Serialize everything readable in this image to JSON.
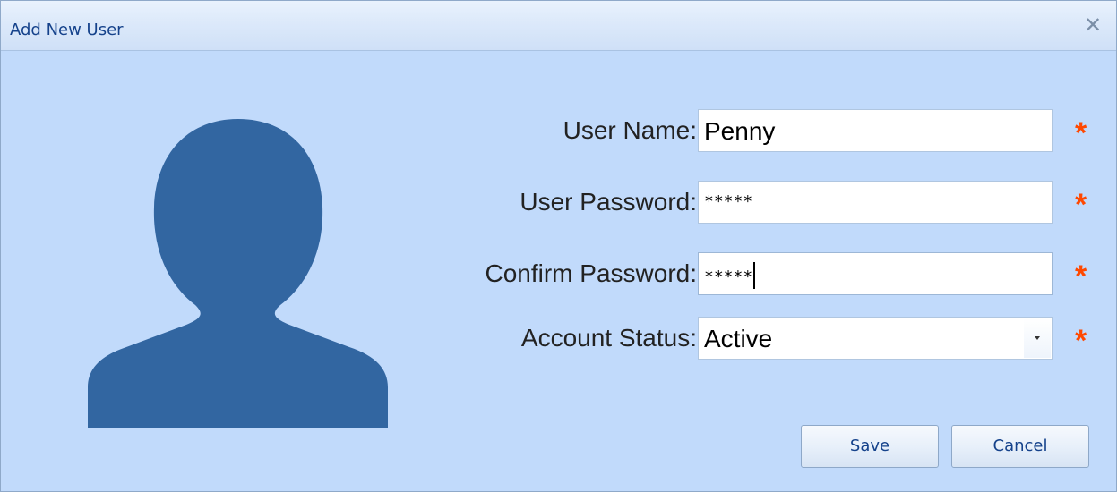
{
  "window": {
    "title": "Add New User",
    "close_glyph": "✕"
  },
  "form": {
    "user_name_label": "User Name:",
    "user_name_value": "Penny",
    "user_password_label": "User Password:",
    "user_password_value": "*****",
    "confirm_password_label": "Confirm Password:",
    "confirm_password_value": "*****",
    "account_status_label": "Account Status:",
    "account_status_value": "Active",
    "required_marker": "*"
  },
  "buttons": {
    "save_label": "Save",
    "cancel_label": "Cancel"
  },
  "colors": {
    "dialog_background": "#c1dafb",
    "avatar": "#3266a1",
    "required_marker": "#ff4800",
    "title_text": "#15428b"
  },
  "icons": {
    "avatar": "user-silhouette-icon",
    "close": "close-icon",
    "dropdown": "chevron-down-icon"
  }
}
